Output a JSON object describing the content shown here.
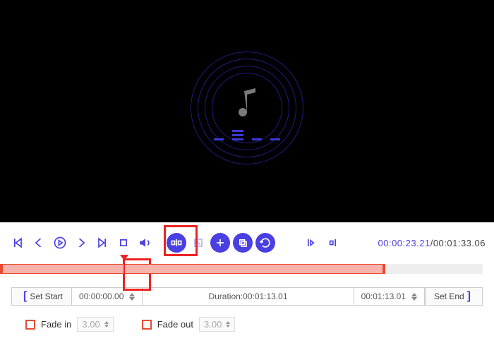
{
  "preview": {
    "icon": "music-note-icon"
  },
  "transport": {
    "current_time": "00:00:23.21",
    "total_time": "00:01:33.06"
  },
  "timeline": {
    "selection_start_pct": 0,
    "selection_end_pct": 78,
    "playhead_pct": 25
  },
  "segment": {
    "set_start_label": "Set Start",
    "start_time": "00:00:00.00",
    "duration_label": "Duration:",
    "duration_value": "00:01:13.01",
    "end_time": "00:01:13.01",
    "set_end_label": "Set End"
  },
  "fade": {
    "in_label": "Fade in",
    "in_value": "3.00",
    "out_label": "Fade out",
    "out_value": "3.00"
  }
}
